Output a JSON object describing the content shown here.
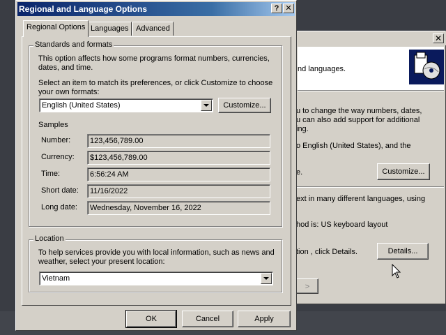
{
  "background_window": {
    "header_text": "nd languages.",
    "intro_line1": "u to change the way numbers, dates,",
    "intro_line2": "u can also add support for additional",
    "intro_line3": "ing.",
    "locale_line": "o English (United States), and the",
    "customize_partial": "e.",
    "customize_button": "Customize...",
    "lang_line": "ext in many different languages, using",
    "method_line": "hod is: US keyboard layout",
    "details_line": "tion , click Details.",
    "details_button": "Details...",
    "close_glyph": "✕",
    "partial_button_glyph": ">"
  },
  "dialog": {
    "title": "Regional and Language Options",
    "help_glyph": "?",
    "close_glyph": "✕",
    "tabs": [
      {
        "label": "Regional Options",
        "active": true
      },
      {
        "label": "Languages",
        "active": false
      },
      {
        "label": "Advanced",
        "active": false
      }
    ],
    "standards": {
      "group_label": "Standards and formats",
      "desc_line1": "This option affects how some programs format numbers, currencies,",
      "desc_line2": "dates, and time.",
      "select_line1": "Select an item to match its preferences, or click Customize to choose",
      "select_line2": "your own formats:",
      "selected_format": "English (United States)",
      "customize_button": "Customize...",
      "samples_title": "Samples",
      "samples": [
        {
          "label": "Number:",
          "value": "123,456,789.00"
        },
        {
          "label": "Currency:",
          "value": "$123,456,789.00"
        },
        {
          "label": "Time:",
          "value": "6:56:24 AM"
        },
        {
          "label": "Short date:",
          "value": "11/16/2022"
        },
        {
          "label": "Long date:",
          "value": "Wednesday, November 16, 2022"
        }
      ]
    },
    "location": {
      "group_label": "Location",
      "desc_line1": "To help services provide you with local information, such as news and",
      "desc_line2": "weather, select your present location:",
      "selected_location": "Vietnam"
    },
    "buttons": {
      "ok": "OK",
      "cancel": "Cancel",
      "apply": "Apply"
    }
  },
  "colors": {
    "title_active_start": "#0a246a",
    "title_active_end": "#a6caf0",
    "face": "#d4d0c8",
    "desktop": "#3a3d44"
  }
}
